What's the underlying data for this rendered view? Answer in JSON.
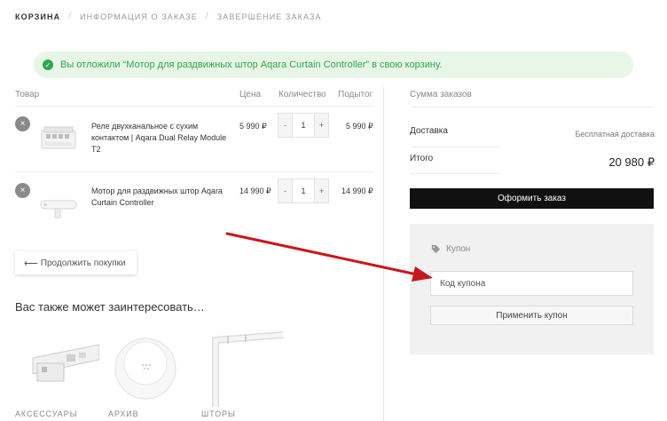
{
  "breadcrumb": {
    "step1": "Корзина",
    "step2": "Информация о заказе",
    "step3": "Завершение заказа",
    "separator": "/"
  },
  "notice": {
    "icon": "check-icon",
    "text": "Вы отложили “Мотор для раздвижных штор Aqara Curtain Controller” в свою корзину."
  },
  "table": {
    "headers": {
      "product": "Товар",
      "price": "Цена",
      "quantity": "Количество",
      "subtotal": "Подытог"
    },
    "rows": [
      {
        "remove": "×",
        "name": "Реле двухканальное с сухим контактом | Aqara Dual Relay Module T2",
        "price": "5 990 ₽",
        "minus": "-",
        "qty": "1",
        "plus": "+",
        "subtotal": "5 990 ₽"
      },
      {
        "remove": "×",
        "name": "Мотор для раздвижных штор Aqara Curtain Controller",
        "price": "14 990 ₽",
        "minus": "-",
        "qty": "1",
        "plus": "+",
        "subtotal": "14 990 ₽"
      }
    ]
  },
  "continue_shopping": {
    "arrow": "⟵",
    "label": "Продолжить покупки"
  },
  "also": {
    "title": "Вас также может заинтересовать…",
    "categories": [
      "Аксессуары",
      "Архив",
      "Шторы"
    ]
  },
  "summary": {
    "title": "Сумма заказов",
    "shipping_label": "Доставка",
    "shipping_value": "Бесплатная доставка",
    "total_label": "Итого",
    "total_value": "20 980 ₽",
    "checkout_label": "Оформить заказ"
  },
  "coupon": {
    "title": "Купон",
    "placeholder": "Код купона",
    "apply_label": "Применить купон"
  },
  "colors": {
    "notice_bg": "#e8f6e8",
    "notice_text": "#2ea84a",
    "checkout_bg": "#111111",
    "annotation_arrow": "#c8171c"
  }
}
